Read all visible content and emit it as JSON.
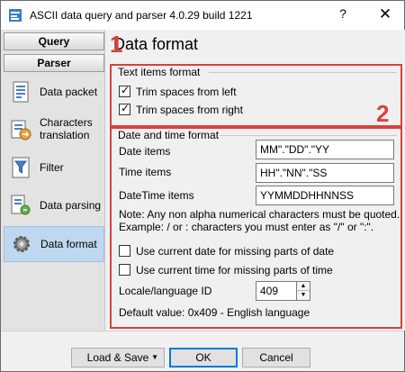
{
  "window": {
    "title": "ASCII data query and parser 4.0.29 build 1221",
    "help_label": "?",
    "close_label": "✕"
  },
  "sidebar": {
    "query_label": "Query",
    "parser_label": "Parser",
    "items": [
      {
        "label": "Data packet",
        "icon": "data-packet-icon"
      },
      {
        "label": "Characters translation",
        "icon": "characters-translation-icon"
      },
      {
        "label": "Filter",
        "icon": "filter-icon"
      },
      {
        "label": "Data parsing",
        "icon": "data-parsing-icon"
      },
      {
        "label": "Data format",
        "icon": "gear-icon",
        "selected": true
      }
    ]
  },
  "main": {
    "title": "Data format",
    "marker1": "1",
    "marker2": "2",
    "text_items": {
      "title": "Text items format",
      "trim_left_label": "Trim spaces from left",
      "trim_left_checked": true,
      "trim_right_label": "Trim spaces from right",
      "trim_right_checked": true
    },
    "datetime": {
      "title": "Date and time format",
      "date_label": "Date items",
      "date_value": "MM\".\"DD\".\"YY",
      "time_label": "Time items",
      "time_value": "HH\".\"NN\".\"SS",
      "datetime_label": "DateTime items",
      "datetime_value": "YYMMDDHHNNSS",
      "note_line1": "Note: Any non alpha numerical characters must be quoted.",
      "note_line2": "Example: / or : characters you must enter as \"/\" or \":\".",
      "use_date_label": "Use current date for missing parts of date",
      "use_date_checked": false,
      "use_time_label": "Use current time for missing parts of time",
      "use_time_checked": false,
      "locale_label": "Locale/language ID",
      "locale_value": "409",
      "default_value_text": "Default value: 0x409 - English language"
    }
  },
  "footer": {
    "load_save_label": "Load & Save",
    "ok_label": "OK",
    "cancel_label": "Cancel"
  },
  "colors": {
    "accent_red": "#d9413a",
    "selection": "#bfd8ef",
    "default_button_border": "#0078d7"
  }
}
